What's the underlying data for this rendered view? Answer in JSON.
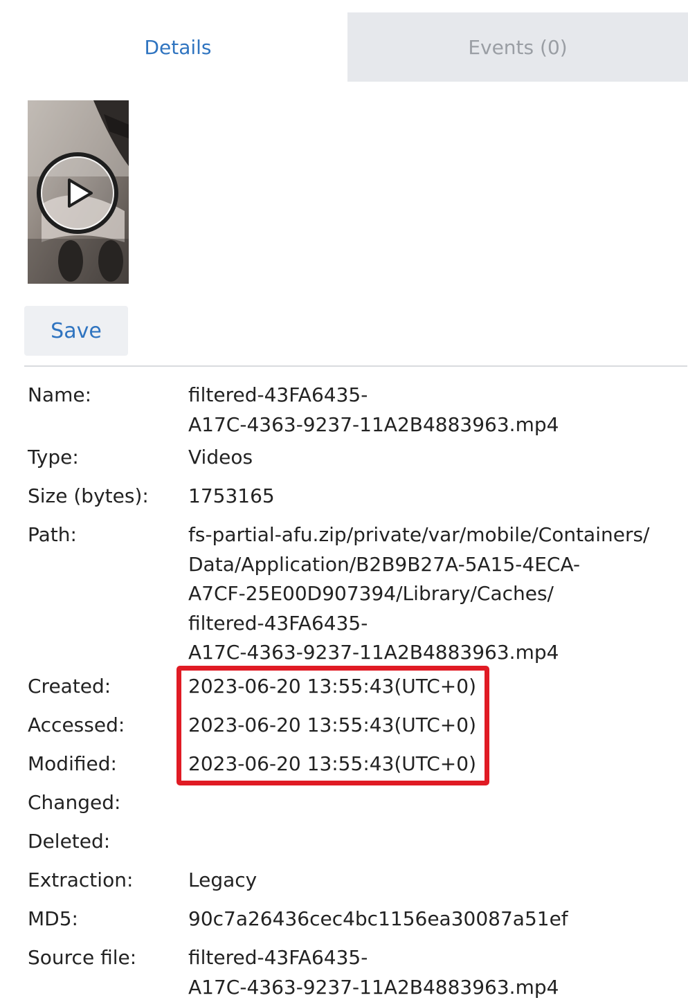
{
  "tabs": [
    {
      "label": "Details",
      "active": true
    },
    {
      "label": "Events (0)",
      "active": false
    }
  ],
  "thumbnail": {
    "icon": "play-icon"
  },
  "actions": {
    "save_label": "Save"
  },
  "details": {
    "name": {
      "label": "Name:",
      "lines": [
        "filtered-43FA6435-",
        "A17C-4363-9237-11A2B4883963.mp4"
      ]
    },
    "type": {
      "label": "Type:",
      "value": "Videos"
    },
    "size": {
      "label": "Size (bytes):",
      "value": "1753165"
    },
    "path": {
      "label": "Path:",
      "lines": [
        "fs-partial-afu.zip/private/var/mobile/Containers/",
        "Data/Application/B2B9B27A-5A15-4ECA-",
        "A7CF-25E00D907394/Library/Caches/",
        "filtered-43FA6435-",
        "A17C-4363-9237-11A2B4883963.mp4"
      ]
    },
    "created": {
      "label": "Created:",
      "value": "2023-06-20 13:55:43(UTC+0)"
    },
    "accessed": {
      "label": "Accessed:",
      "value": "2023-06-20 13:55:43(UTC+0)"
    },
    "modified": {
      "label": "Modified:",
      "value": "2023-06-20 13:55:43(UTC+0)"
    },
    "changed": {
      "label": "Changed:",
      "value": ""
    },
    "deleted": {
      "label": "Deleted:",
      "value": ""
    },
    "extraction": {
      "label": "Extraction:",
      "value": "Legacy"
    },
    "md5": {
      "label": "MD5:",
      "value": "90c7a26436cec4bc1156ea30087a51ef"
    },
    "source_file": {
      "label": "Source file:",
      "lines": [
        "filtered-43FA6435-",
        "A17C-4363-9237-11A2B4883963.mp4"
      ]
    }
  },
  "colors": {
    "accent": "#2f74c0",
    "highlight": "#e01b24"
  }
}
